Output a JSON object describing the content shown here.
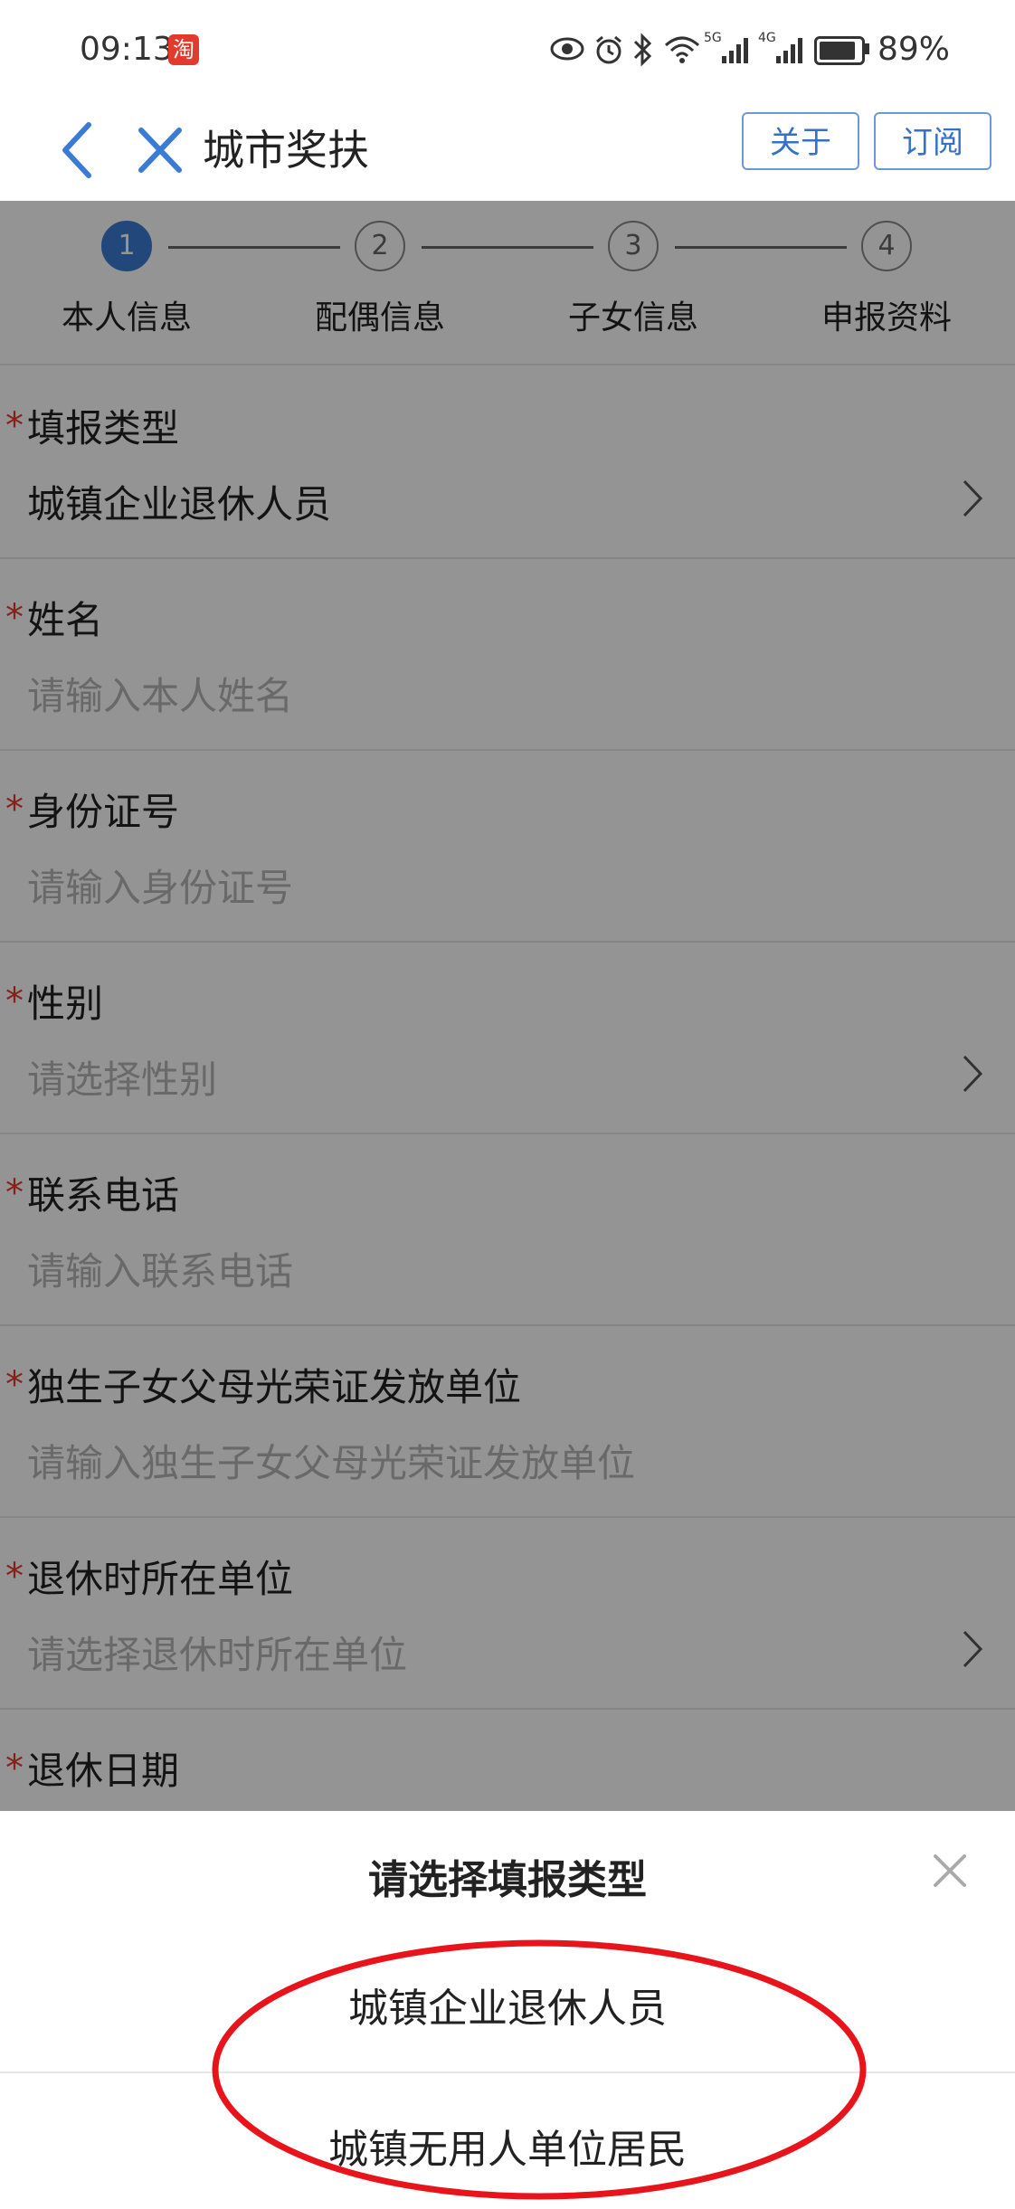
{
  "status_bar": {
    "time": "09:13",
    "badge": "淘",
    "network_5g": "5G",
    "network_4g": "4G",
    "battery_percent": "89%",
    "battery_level": 0.89
  },
  "nav": {
    "title": "城市奖扶",
    "about_label": "关于",
    "subscribe_label": "订阅"
  },
  "steps": [
    {
      "number": "1",
      "label": "本人信息",
      "active": true
    },
    {
      "number": "2",
      "label": "配偶信息",
      "active": false
    },
    {
      "number": "3",
      "label": "子女信息",
      "active": false
    },
    {
      "number": "4",
      "label": "申报资料",
      "active": false
    }
  ],
  "form": {
    "required_mark": "*",
    "fields": [
      {
        "label": "填报类型",
        "value": "城镇企业退休人员",
        "placeholder": ""
      },
      {
        "label": "姓名",
        "value": "",
        "placeholder": "请输入本人姓名"
      },
      {
        "label": "身份证号",
        "value": "",
        "placeholder": "请输入身份证号"
      },
      {
        "label": "性别",
        "value": "",
        "placeholder": "请选择性别"
      },
      {
        "label": "联系电话",
        "value": "",
        "placeholder": "请输入联系电话"
      },
      {
        "label": "独生子女父母光荣证发放单位",
        "value": "",
        "placeholder": "请输入独生子女父母光荣证发放单位"
      },
      {
        "label": "退休时所在单位",
        "value": "",
        "placeholder": "请选择退休时所在单位"
      },
      {
        "label": "退休日期",
        "value": "",
        "placeholder": ""
      }
    ]
  },
  "sheet": {
    "title": "请选择填报类型",
    "options": [
      "城镇企业退休人员",
      "城镇无用人单位居民"
    ]
  },
  "colors": {
    "accent": "#3a7bd5",
    "required": "#e23b2e",
    "annotation": "#e8141c"
  }
}
